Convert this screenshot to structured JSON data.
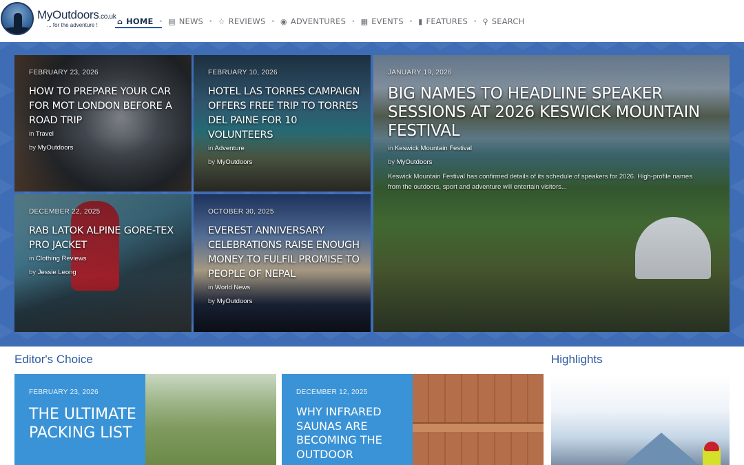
{
  "site": {
    "name": "MyOutdoors",
    "tld": ".co.uk",
    "tagline": "... for the adventure !"
  },
  "nav": [
    {
      "label": "HOME",
      "icon": "home-icon",
      "active": true
    },
    {
      "label": "NEWS",
      "icon": "newspaper-icon"
    },
    {
      "label": "REVIEWS",
      "icon": "star-icon"
    },
    {
      "label": "ADVENTURES",
      "icon": "compass-icon"
    },
    {
      "label": "EVENTS",
      "icon": "calendar-icon"
    },
    {
      "label": "FEATURES",
      "icon": "book-icon"
    },
    {
      "label": "SEARCH",
      "icon": "search-icon"
    }
  ],
  "featured": [
    {
      "date": "FEBRUARY 23, 2026",
      "title": "HOW TO PREPARE YOUR CAR FOR MOT LONDON BEFORE A ROAD TRIP",
      "in": "in",
      "category": "Travel",
      "by": "by",
      "author": "MyOutdoors"
    },
    {
      "date": "FEBRUARY 10, 2026",
      "title": "HOTEL LAS TORRES CAMPAIGN OFFERS FREE TRIP TO TORRES DEL PAINE FOR 10 VOLUNTEERS",
      "in": "in",
      "category": "Adventure",
      "by": "by",
      "author": "MyOutdoors"
    },
    {
      "date": "DECEMBER 22, 2025",
      "title": "RAB LATOK ALPINE GORE-TEX PRO JACKET",
      "in": "in",
      "category": "Clothing Reviews",
      "by": "by",
      "author": "Jessie Leong"
    },
    {
      "date": "OCTOBER 30, 2025",
      "title": "EVEREST ANNIVERSARY CELEBRATIONS RAISE ENOUGH MONEY TO FULFIL PROMISE TO PEOPLE OF NEPAL",
      "in": "in",
      "category": "World News",
      "by": "by",
      "author": "MyOutdoors"
    },
    {
      "date": "JANUARY 19, 2026",
      "title": "BIG NAMES TO HEADLINE SPEAKER SESSIONS AT 2026 KESWICK MOUNTAIN FESTIVAL",
      "in": "in",
      "category": "Keswick Mountain Festival",
      "by": "by",
      "author": "MyOutdoors",
      "excerpt": "Keswick Mountain Festival has confirmed details of its schedule of speakers for 2026. High-profile names from the outdoors, sport and adventure will entertain visitors..."
    }
  ],
  "editors_choice": {
    "heading": "Editor's Choice",
    "items": [
      {
        "date": "FEBRUARY 23, 2026",
        "title": "THE ULTIMATE PACKING LIST"
      },
      {
        "date": "DECEMBER 12, 2025",
        "title": "WHY INFRARED SAUNAS ARE BECOMING THE OUTDOOR"
      }
    ]
  },
  "highlights": {
    "heading": "Highlights"
  },
  "colors": {
    "brand_blue": "#2c5aa0",
    "hero_bg": "#3e6db5",
    "card_blue": "#3a93d6"
  }
}
